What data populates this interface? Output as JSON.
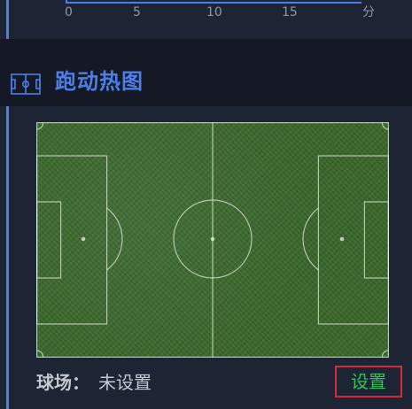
{
  "chart": {
    "x_ticks": [
      "0",
      "5",
      "10",
      "15"
    ],
    "x_unit": "分",
    "accent_color": "#4d7fe8"
  },
  "heatmap_section": {
    "icon": "pitch-icon",
    "title": "跑动热图",
    "venue_label": "球场：",
    "venue_value": "未设置",
    "settings_label": "设置",
    "settings_color": "#33c25a",
    "settings_border_color": "#d9283a"
  }
}
